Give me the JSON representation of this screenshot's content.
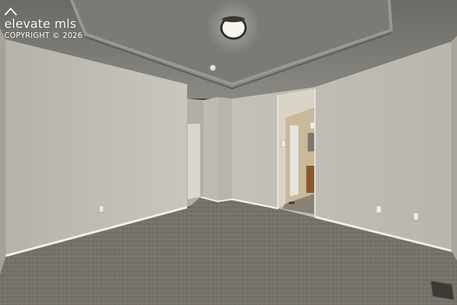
{
  "watermark": {
    "brand": "elevate mls",
    "copyright": "COPYRIGHT © 2026"
  }
}
